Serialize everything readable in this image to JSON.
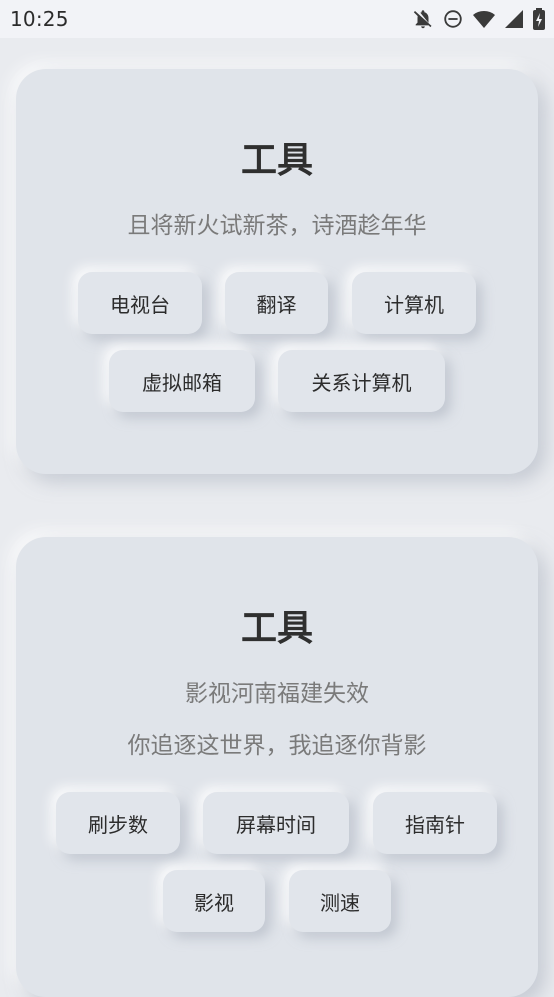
{
  "status_bar": {
    "time": "10:25",
    "icons": [
      "notifications-off-icon",
      "do-not-disturb-icon",
      "wifi-icon",
      "cell-signal-icon",
      "battery-charging-icon"
    ]
  },
  "cards": [
    {
      "title": "工具",
      "subtitle": "且将新火试新茶，诗酒趁年华",
      "buttons": [
        "电视台",
        "翻译",
        "计算机",
        "虚拟邮箱",
        "关系计算机"
      ]
    },
    {
      "title": "工具",
      "subtitle_lines": [
        "影视河南福建失效",
        "你追逐这世界，我追逐你背影"
      ],
      "buttons": [
        "刷步数",
        "屏幕时间",
        "指南针",
        "影视",
        "测速"
      ]
    }
  ]
}
